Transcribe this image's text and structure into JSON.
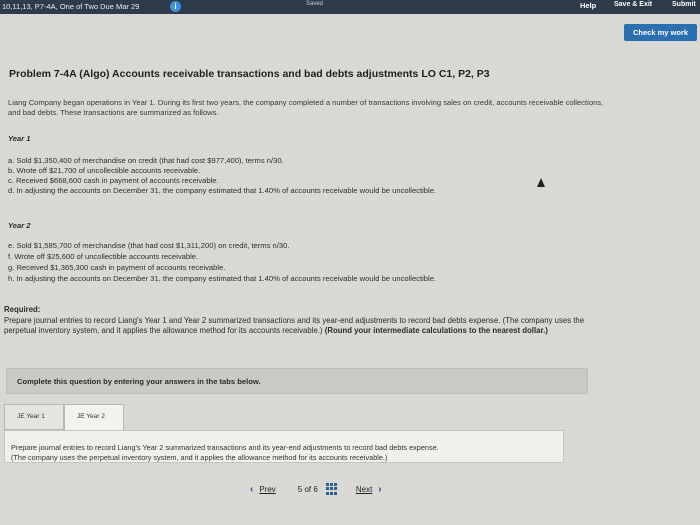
{
  "header": {
    "assignment": "10,11,13, P7-4A, One of Two Due Mar 29",
    "saved": "Saved",
    "help": "Help",
    "save_exit": "Save & Exit",
    "submit": "Submit"
  },
  "check_button": "Check my work",
  "problem": {
    "title": "Problem 7-4A (Algo) Accounts receivable transactions and bad debts adjustments LO C1, P2, P3",
    "intro": "Liang Company began operations in Year 1. During its first two years, the company completed a number of transactions involving sales on credit, accounts receivable collections, and bad debts. These transactions are summarized as follows.",
    "year1_label": "Year 1",
    "year1": [
      "a. Sold $1,350,400 of merchandise on credit (that had cost $977,400), terms n/30.",
      "b. Wrote off $21,700 of uncollectible accounts receivable.",
      "c. Received $668,600 cash in payment of accounts receivable.",
      "d. In adjusting the accounts on December 31, the company estimated that 1.40% of accounts receivable would be uncollectible."
    ],
    "year2_label": "Year 2",
    "year2": [
      "e. Sold $1,585,700 of merchandise (that had cost $1,311,200) on credit, terms n/30.",
      "f. Wrote off $25,600 of uncollectible accounts receivable.",
      "g. Received $1,365,300 cash in payment of accounts receivable.",
      "h. In adjusting the accounts on December 31, the company estimated that 1.40% of accounts receivable would be uncollectible."
    ]
  },
  "required": {
    "heading": "Required:",
    "text": "Prepare journal entries to record Liang's Year 1 and Year 2 summarized transactions and its year-end adjustments to record bad debts expense. (The company uses the perpetual inventory system, and it applies the allowance method for its accounts receivable.) ",
    "bold_text": "(Round your intermediate calculations to the nearest dollar.)"
  },
  "complete_prompt": "Complete this question by entering your answers in the tabs below.",
  "tabs": [
    {
      "label": "JE Year 1"
    },
    {
      "label": "JE Year 2"
    }
  ],
  "tab_panel": {
    "line1": "Prepare journal entries to record Liang's Year 2 summarized transactions and its year-end adjustments to record bad debts expense.",
    "line2": "(The company uses the perpetual inventory system, and it applies the allowance method for its accounts receivable.)"
  },
  "pager": {
    "prev": "Prev",
    "current": "5",
    "of_label": "of",
    "total": "6",
    "next": "Next"
  },
  "colors": {
    "topbar": "#2d3b4a",
    "accent": "#2c6fb0"
  }
}
